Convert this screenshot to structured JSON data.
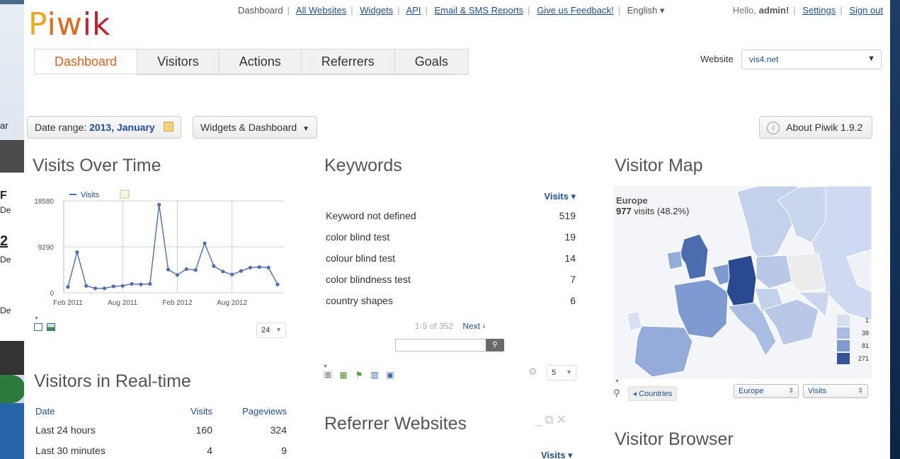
{
  "desktop": {
    "left_fragments": [
      "ar",
      "F",
      "De",
      "2",
      "De",
      "De"
    ]
  },
  "logo": "Piwik",
  "top_nav": {
    "items": [
      "Dashboard",
      "All Websites",
      "Widgets",
      "API",
      "Email & SMS Reports",
      "Give us Feedback!",
      "English ▾"
    ]
  },
  "user_nav": {
    "greeting": "Hello,",
    "user": "admin!",
    "settings": "Settings",
    "signout": "Sign out"
  },
  "tabs": [
    "Dashboard",
    "Visitors",
    "Actions",
    "Referrers",
    "Goals"
  ],
  "website": {
    "label": "Website",
    "value": "vis4.net"
  },
  "toolbar": {
    "date_label": "Date range:",
    "date_value": "2013, January",
    "widgets_button": "Widgets & Dashboard",
    "about": "About Piwik 1.9.2"
  },
  "visits_over_time": {
    "title": "Visits Over Time",
    "limit": "24"
  },
  "chart_data": {
    "type": "line",
    "legend": [
      "Visits"
    ],
    "x_tick_labels": [
      "Feb 2011",
      "Aug 2011",
      "Feb 2012",
      "Aug 2012"
    ],
    "y_tick_labels": [
      "18580",
      "9290",
      "0"
    ],
    "ylim": [
      0,
      18580
    ],
    "grid": true,
    "series": [
      {
        "name": "Visits",
        "color": "#4c6fb4",
        "values": [
          1200,
          8200,
          1400,
          900,
          900,
          1300,
          1400,
          1800,
          1700,
          1800,
          17800,
          4700,
          3600,
          4800,
          4600,
          10000,
          5400,
          4300,
          3700,
          4400,
          5100,
          5200,
          5100,
          1700
        ]
      }
    ]
  },
  "keywords": {
    "title": "Keywords",
    "column": "Visits ▾",
    "rows": [
      {
        "label": "Keyword not defined",
        "value": "519"
      },
      {
        "label": "color blind test",
        "value": "19"
      },
      {
        "label": "colour blind test",
        "value": "14"
      },
      {
        "label": "color blindness test",
        "value": "7"
      },
      {
        "label": "country shapes",
        "value": "6"
      }
    ],
    "pager": "1-5 of 352",
    "next": "Next ›",
    "limit": "5"
  },
  "realtime": {
    "title": "Visitors in Real-time",
    "headers": [
      "Date",
      "Visits",
      "Pageviews"
    ],
    "rows": [
      [
        "Last 24 hours",
        "160",
        "324"
      ],
      [
        "Last 30 minutes",
        "4",
        "9"
      ]
    ]
  },
  "referrer_websites": {
    "title": "Referrer Websites",
    "column": "Visits ▾"
  },
  "visitor_map": {
    "title": "Visitor Map",
    "region": "Europe",
    "visits_bold": "977",
    "visits_rest": "visits (48.2%)",
    "legend": [
      {
        "value": "1",
        "color": "#d6e0f0"
      },
      {
        "value": "38",
        "color": "#a9bde2"
      },
      {
        "value": "81",
        "color": "#7e9acf"
      },
      {
        "value": "271",
        "color": "#34559c"
      }
    ],
    "countries_btn": "Countries",
    "region_select": "Europe",
    "metric_select": "Visits"
  },
  "visitor_browser": {
    "title": "Visitor Browser"
  }
}
